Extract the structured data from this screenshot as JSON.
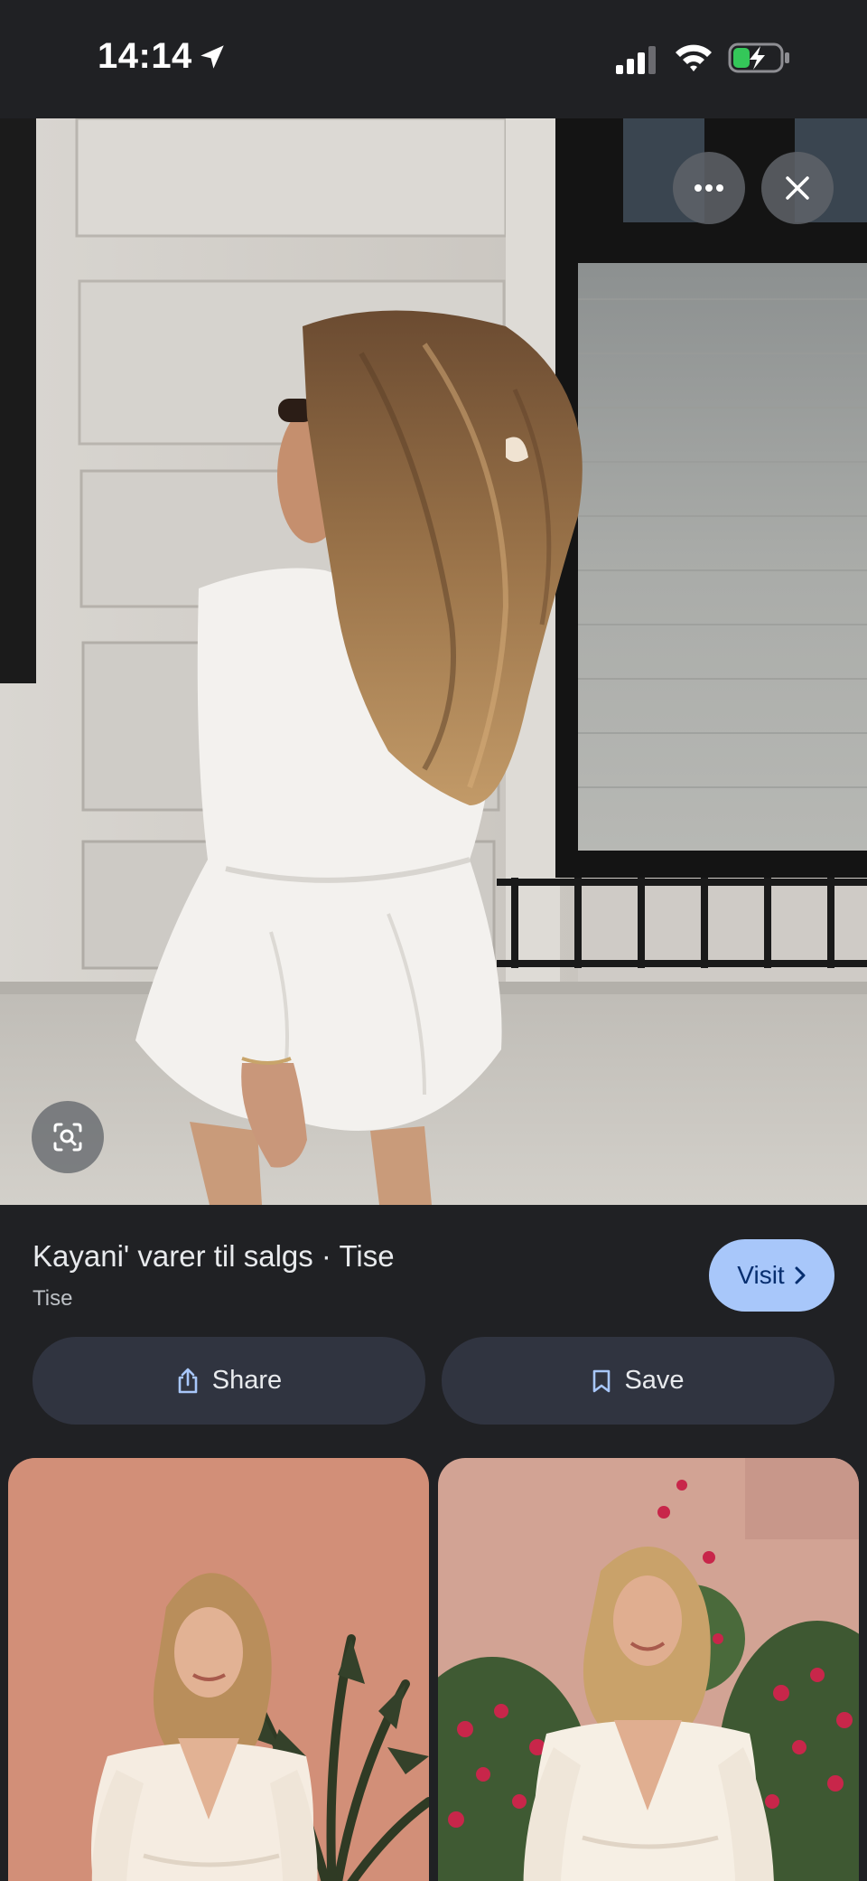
{
  "status_bar": {
    "time": "14:14",
    "icons": [
      "location-arrow-icon",
      "cellular-signal-icon",
      "wifi-icon",
      "battery-charging-icon"
    ],
    "battery_color": "#34c759"
  },
  "hero": {
    "overlay_icons": [
      "more-horizontal-icon",
      "close-icon",
      "lens-search-icon"
    ]
  },
  "result": {
    "title": "Kayani' varer til salgs · Tise",
    "source": "Tise",
    "visit_label": "Visit",
    "share_label": "Share",
    "save_label": "Save"
  },
  "theme": {
    "background": "#202124",
    "visit_button": "#a8c7fa",
    "action_button": "#303440"
  }
}
